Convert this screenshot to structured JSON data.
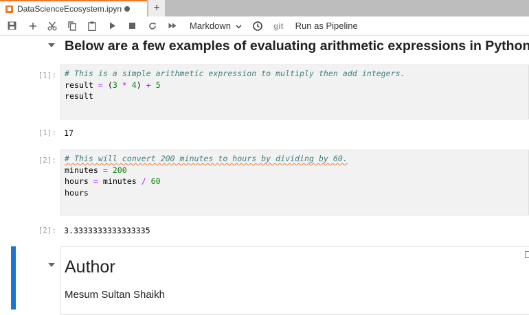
{
  "tab": {
    "title": "DataScienceEcosystem.ipyn",
    "new_tab_symbol": "+"
  },
  "toolbar": {
    "icons": [
      "save-icon",
      "add-icon",
      "cut-icon",
      "copy-icon",
      "paste-icon",
      "run-icon",
      "stop-icon",
      "restart-icon",
      "fast-forward-icon"
    ],
    "cell_type": "Markdown",
    "git_label": "git",
    "pipeline_label": "Run as Pipeline"
  },
  "cells": {
    "md_heading": "Below are a few examples of evaluating arithmetic expressions in Python.",
    "code1": {
      "prompt": "[1]:",
      "comment": "# This is a simple arithmetic expression to multiply then add integers.",
      "line2": {
        "var": "result ",
        "op_eq": "=",
        "open": " (",
        "n1": "3",
        "op_mul": " * ",
        "n2": "4",
        "close": ")",
        "op_plus": " + ",
        "n3": "5"
      },
      "line3": "result",
      "out_prompt": "[1]:",
      "output": "17"
    },
    "code2": {
      "prompt": "[2]:",
      "comment": "# This will convert 200 minutes to hours by dividing by 60.",
      "line2": {
        "var": "minutes ",
        "op_eq": "=",
        "num": " 200"
      },
      "line3": {
        "var": "hours ",
        "op_eq": "=",
        "mid": " minutes ",
        "op_div": "/",
        "num": " 60"
      },
      "line4": "hours",
      "out_prompt": "[2]:",
      "output": "3.3333333333333335"
    },
    "author": {
      "heading": "Author",
      "name": "Mesum Sultan Shaikh"
    }
  },
  "colors": {
    "accent": "#f37726",
    "active_cell": "#1976d2"
  }
}
